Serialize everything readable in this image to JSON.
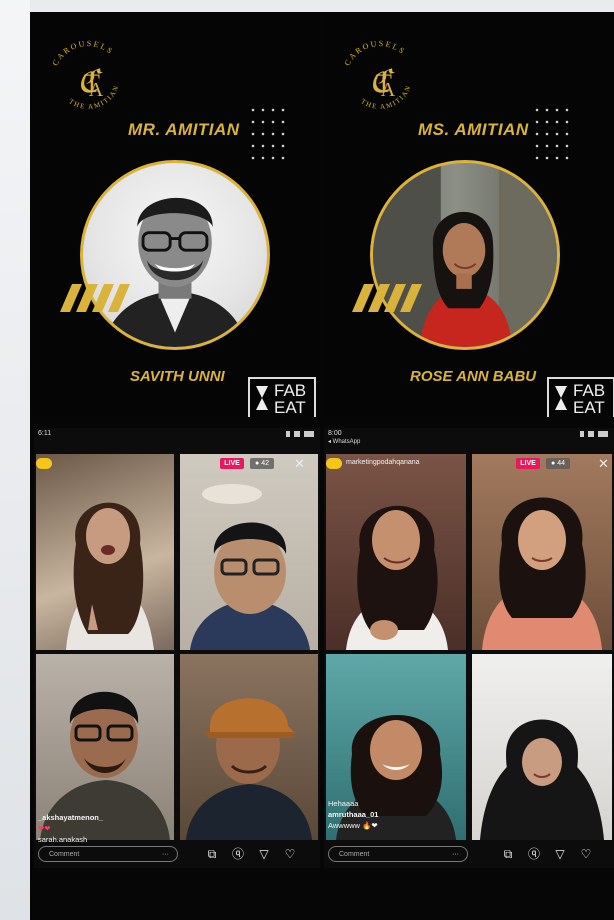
{
  "posters": [
    {
      "logo_text": "CAROUSELS THE AMITIAN",
      "logo_monogram": "CTA",
      "title": "MR. AMITIAN",
      "name": "SAVITH UNNI",
      "brand": [
        "FAB",
        "EAT"
      ]
    },
    {
      "logo_text": "CAROUSELS THE AMITIAN",
      "logo_monogram": "CTA",
      "title": "MS. AMITIAN",
      "name": "ROSE ANN BABU",
      "brand": [
        "FAB",
        "EAT"
      ]
    }
  ],
  "phones": [
    {
      "status_time": "6:11",
      "handle": "",
      "live_label": "LIVE",
      "viewers": "● 42",
      "comments": [
        {
          "user": "_akshayatmenon_",
          "text": "❤❤"
        },
        {
          "user": "",
          "text": "sarah.anakash"
        }
      ],
      "comment_placeholder": "Comment",
      "more": "···"
    },
    {
      "status_time": "8:00",
      "status_sub": "◂ WhatsApp",
      "handle": "marketingpodahqanana",
      "live_label": "LIVE",
      "viewers": "● 44",
      "comments": [
        {
          "user": "",
          "text": "Hehaaaa"
        },
        {
          "user": "amruthaaa_01",
          "text": "Awwwww 🔥❤"
        }
      ],
      "comment_placeholder": "Comment",
      "more": "···"
    }
  ],
  "icons": [
    "camera-flip-icon",
    "question-icon",
    "send-icon",
    "heart-icon"
  ]
}
